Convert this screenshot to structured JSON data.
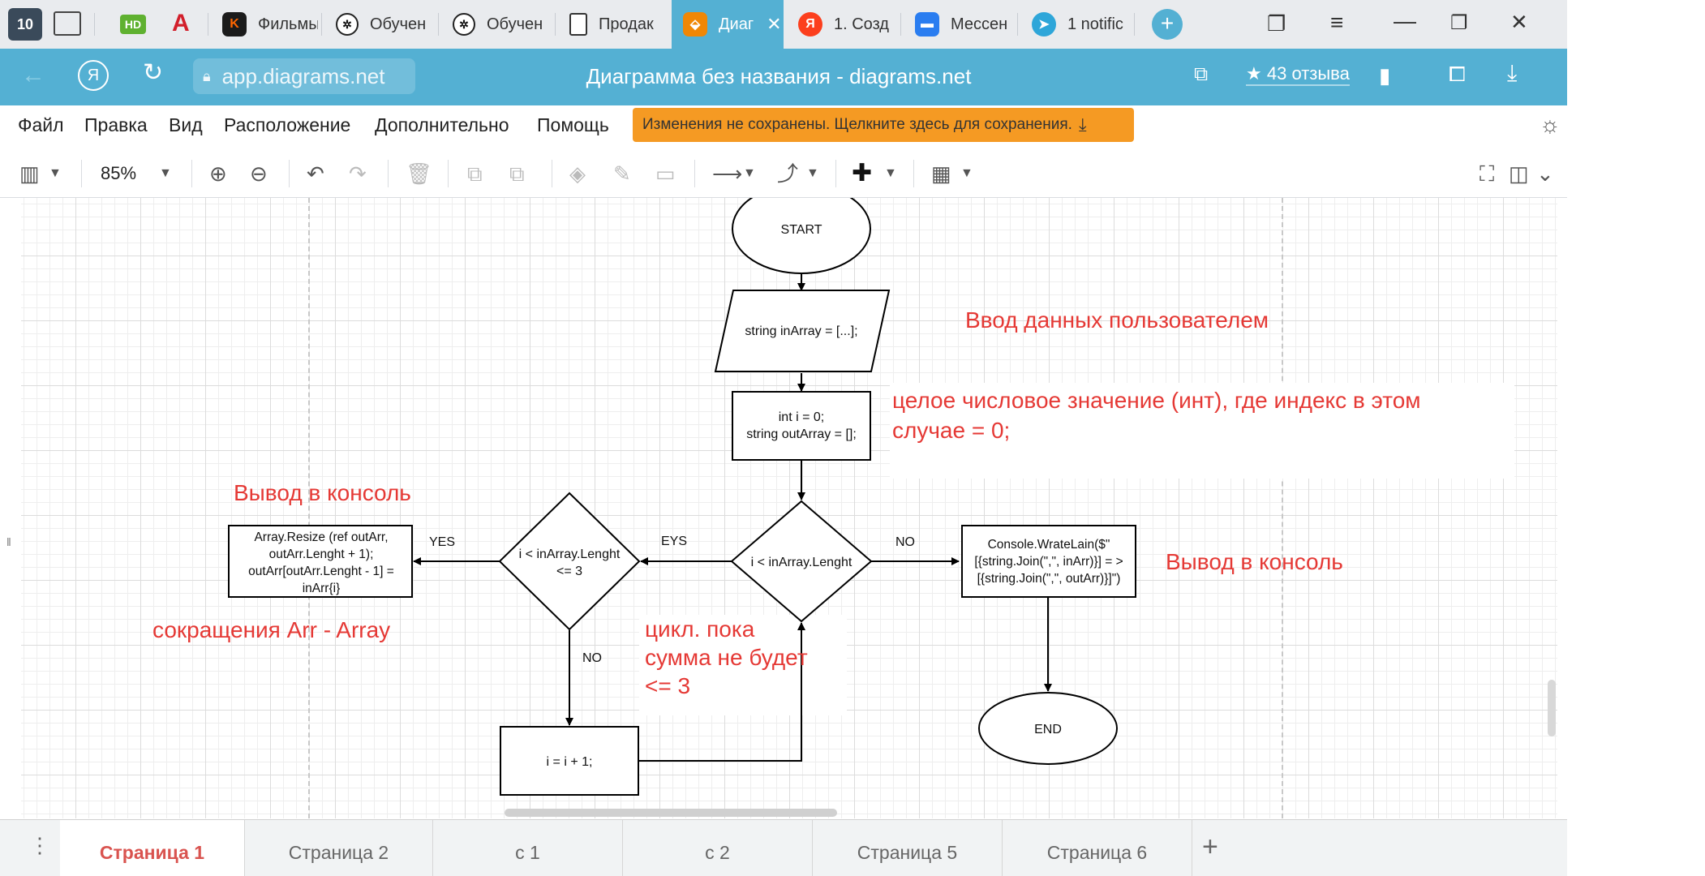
{
  "browser": {
    "tab_counter": "10",
    "tabs": [
      {
        "label": "Фильмы",
        "icon": "kinopoisk-icon",
        "color": "#1b1b1b"
      },
      {
        "label": "Обучен",
        "icon": "chatgpt-icon",
        "color": "#1b1b1b"
      },
      {
        "label": "Обучен",
        "icon": "chatgpt-icon",
        "color": "#1b1b1b"
      },
      {
        "label": "Продак",
        "icon": "document-icon",
        "color": "#ffffff"
      },
      {
        "label": "Диаг",
        "icon": "drawio-icon",
        "color": "#f08705"
      },
      {
        "label": "1. Созд",
        "icon": "yandex-icon",
        "color": "#fc3f1d"
      },
      {
        "label": "Мессен",
        "icon": "messenger-icon",
        "color": "#2a7df0"
      },
      {
        "label": "1 notific",
        "icon": "telegram-icon",
        "color": "#2ea6d9"
      }
    ],
    "pinned": {
      "hd": "HD",
      "a": "A"
    },
    "url": "app.diagrams.net",
    "title": "Диаграмма без названия - diagrams.net",
    "reviews": "43 отзыва"
  },
  "menu": {
    "items": [
      "Файл",
      "Правка",
      "Вид",
      "Расположение",
      "Дополнительно",
      "Помощь"
    ],
    "unsaved": "Изменения не сохранены. Щелкните здесь для сохранения."
  },
  "toolbar": {
    "zoom": "85%"
  },
  "diagram": {
    "start": "START",
    "input": "string inArray = [...];",
    "init_1": "int i = 0;",
    "init_2": "string outArray = [];",
    "cond_main": "i < inArray.Lenght",
    "cond_inner_1": "i < inArray.Lenght",
    "cond_inner_2": "<= 3",
    "resize_1": "Array.Resize (ref outArr,",
    "resize_2": "outArr.Lenght + 1);",
    "resize_3": "outArr[outArr.Lenght - 1] =",
    "resize_4": "inArr{i}",
    "increment": "i = i + 1;",
    "console_1": "Console.WrateLain($\"",
    "console_2": "[{string.Join(\",\", inArr)}] = >",
    "console_3": "[{string.Join(\",\", outArr)}]\")",
    "end": "END",
    "label_yes": "YES",
    "label_eys": "EYS",
    "label_no_main": "NO",
    "label_no_inner": "NO",
    "note_input": "Ввод данных пользователем",
    "note_int_1": "целое числовое значение (инт), где индекс в этом",
    "note_int_2": "случае = 0;",
    "note_output_left": "Вывод в консоль",
    "note_output_right": "Вывод в консоль",
    "note_abbrev": "сокращения Arr - Array",
    "note_loop_1": "цикл. пока",
    "note_loop_2": "сумма не будет",
    "note_loop_3": "<= 3",
    "colors": {
      "note": "#e53935",
      "stroke": "#000000"
    }
  },
  "pages": [
    "Страница 1",
    "Страница 2",
    "с 1",
    "с 2",
    "Страница 5",
    "Страница 6"
  ]
}
